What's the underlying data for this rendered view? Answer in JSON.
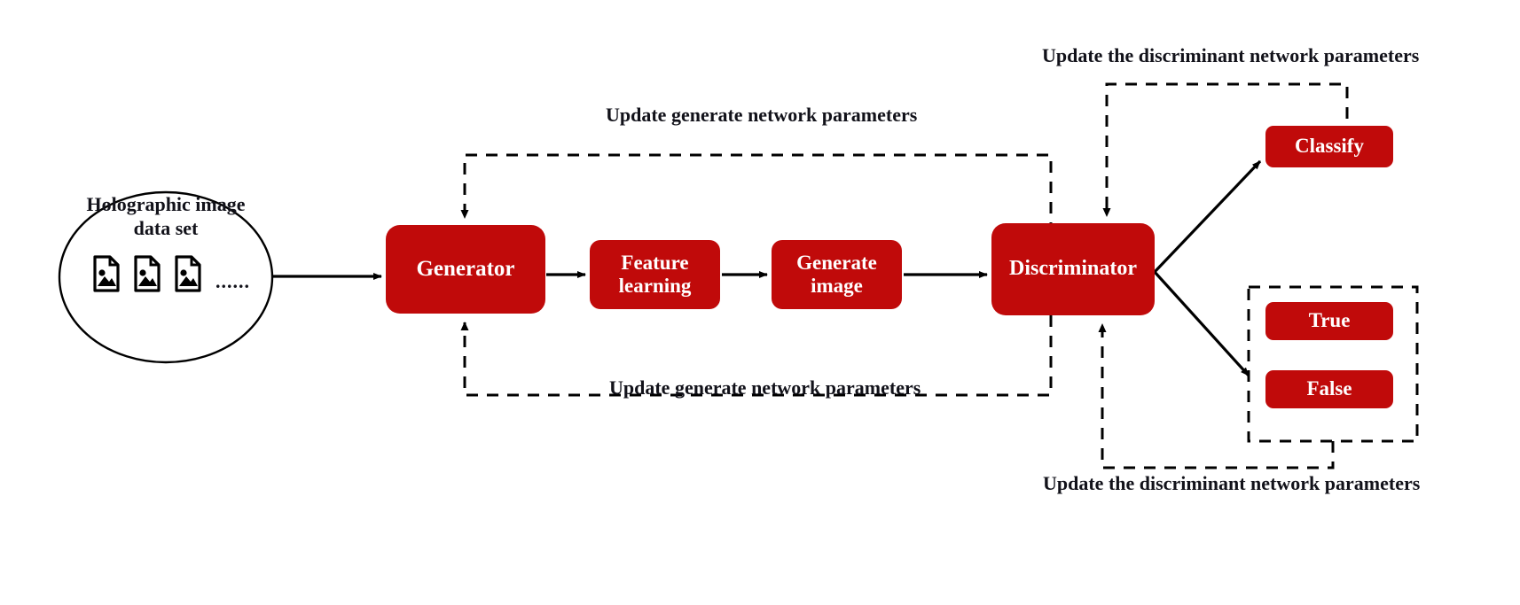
{
  "diagram": {
    "title": "GAN training flow for holographic image data set",
    "accent_color": "#C00A0A",
    "text_color": "#12121a",
    "background": "#ffffff"
  },
  "dataset": {
    "label_line1": "Holographic image",
    "label_line2": "data set",
    "ellipsis": "......",
    "icon_name": "image-file-icon",
    "icon_count": 3
  },
  "nodes": {
    "generator": "Generator",
    "feature_learning_line1": "Feature",
    "feature_learning_line2": "learning",
    "generate_image_line1": "Generate",
    "generate_image_line2": "image",
    "discriminator": "Discriminator",
    "classify": "Classify",
    "true": "True",
    "false": "False"
  },
  "edge_labels": {
    "update_generate_top": "Update generate network parameters",
    "update_generate_bottom": "Update generate network parameters",
    "update_discriminant_top": "Update the discriminant network parameters",
    "update_discriminant_bottom": "Update the discriminant network parameters"
  }
}
